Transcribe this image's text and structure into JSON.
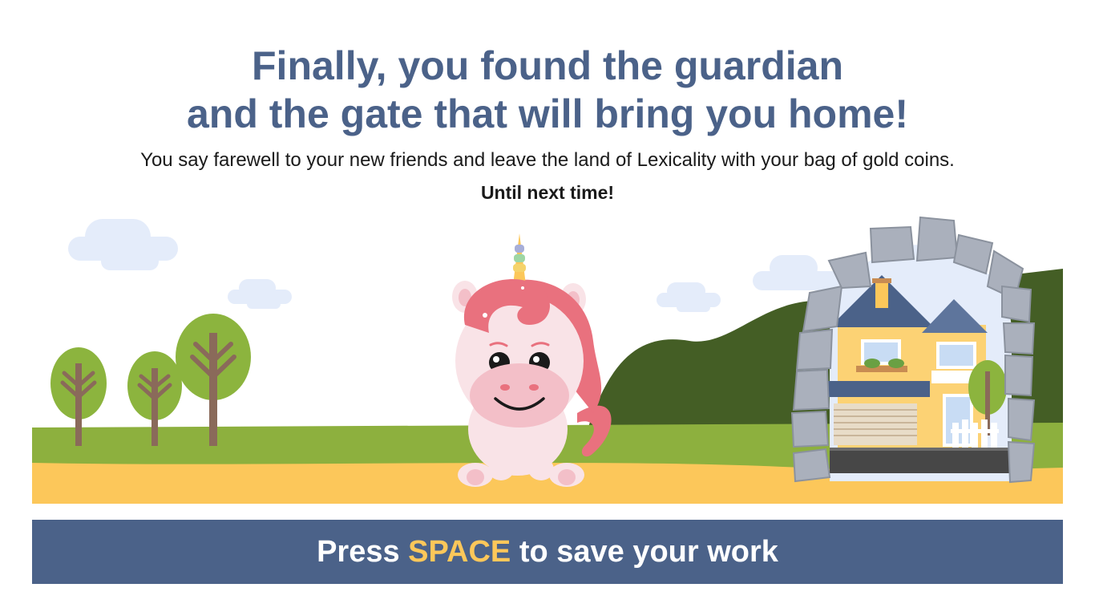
{
  "heading": {
    "line1": "Finally, you found the guardian",
    "line2": "and the gate that will bring you home!"
  },
  "subtitle": "You say farewell to your new friends and leave the land of Lexicality with your bag of gold coins.",
  "closing": "Until next time!",
  "scene": {
    "characters": [
      "unicorn-guardian"
    ],
    "objects": [
      "stone-gate-arch",
      "house",
      "trees",
      "clouds",
      "hill"
    ]
  },
  "cta": {
    "prefix": "Press ",
    "key": "SPACE",
    "suffix": " to save your work"
  },
  "colors": {
    "heading": "#4b6289",
    "cta_background": "#4b6289",
    "cta_key": "#fcc75a",
    "grass": "#8db03e",
    "path": "#fcc75a",
    "hill": "#445e25",
    "tree_canopy": "#8cb43e",
    "tree_trunk": "#8a6a5a",
    "cloud": "#e4ecfa",
    "stone": "#aab0bc",
    "unicorn_body": "#f9e3e7",
    "unicorn_mane": "#e9717e"
  }
}
